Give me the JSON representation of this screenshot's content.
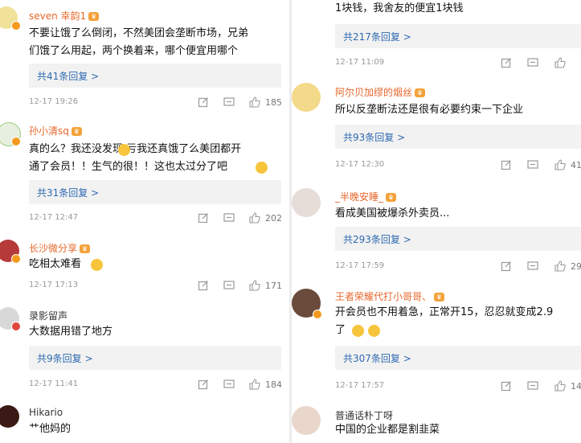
{
  "left_column": [
    {
      "name": "seven 幸韵1",
      "lines": [
        "不要让饿了么倒闭，不然美团会垄断市场，兄弟",
        "们饿了么用起，两个换着来，哪个便宜用哪个"
      ],
      "replies": "共41条回复 >",
      "time": "12-17 19:26",
      "likes": "185"
    },
    {
      "name": "孙小清sq",
      "lines": [
        "真的么？我还没发现 亏我还真饿了么美团都开",
        "通了会员！！生气的很！！这也太过分了吧"
      ],
      "replies": "共31条回复 >",
      "time": "12-17 12:47",
      "likes": "202"
    },
    {
      "name": "长沙微分享",
      "lines": [
        "吃相太难看"
      ],
      "replies": "",
      "time": "12-17 17:13",
      "likes": "171"
    },
    {
      "name": "录影留声",
      "lines": [
        "大数据用错了地方"
      ],
      "replies": "共9条回复 >",
      "time": "12-17 11:41",
      "likes": "184"
    },
    {
      "name": "Hikario",
      "lines": [
        "艹他妈的"
      ],
      "replies": "",
      "time": "",
      "likes": ""
    }
  ],
  "right_column": [
    {
      "name": "",
      "lines": [
        "1块钱，我舍友的便宜1块钱"
      ],
      "replies": "共217条回复 >",
      "time": "12-17 11:09",
      "likes": ""
    },
    {
      "name": "阿尔贝加缪的烟丝",
      "lines": [
        "所以反垄断法还是很有必要约束一下企业"
      ],
      "replies": "共93条回复 >",
      "time": "12-17 12:30",
      "likes": "41"
    },
    {
      "name": "_半晚安睡_",
      "lines": [
        "看成美国被爆杀外卖员..."
      ],
      "replies": "共293条回复 >",
      "time": "12-17 17:59",
      "likes": "29"
    },
    {
      "name": "王者荣耀代打小哥哥、",
      "lines": [
        "开会员也不用着急，正常开15，忍忍就变成2.9",
        "了"
      ],
      "replies": "共307条回复 >",
      "time": "12-17 17:57",
      "likes": "14"
    },
    {
      "name": "普通话朴丁呀",
      "lines": [
        "中国的企业都是割韭菜"
      ],
      "replies": "",
      "time": "",
      "likes": ""
    }
  ],
  "colors": {
    "name": "#e8672b",
    "name_plain": "#333333",
    "reply_link": "#2e6ab0",
    "meta": "#999999",
    "crown": "#f3a23a",
    "vip": "#f39a1e"
  },
  "icons": {
    "repost": "share-edit-icon",
    "comment": "comment-icon",
    "like": "thumbs-up-icon",
    "crown": "vip-crown-icon",
    "emoji": "smiley-emoji-icon"
  }
}
